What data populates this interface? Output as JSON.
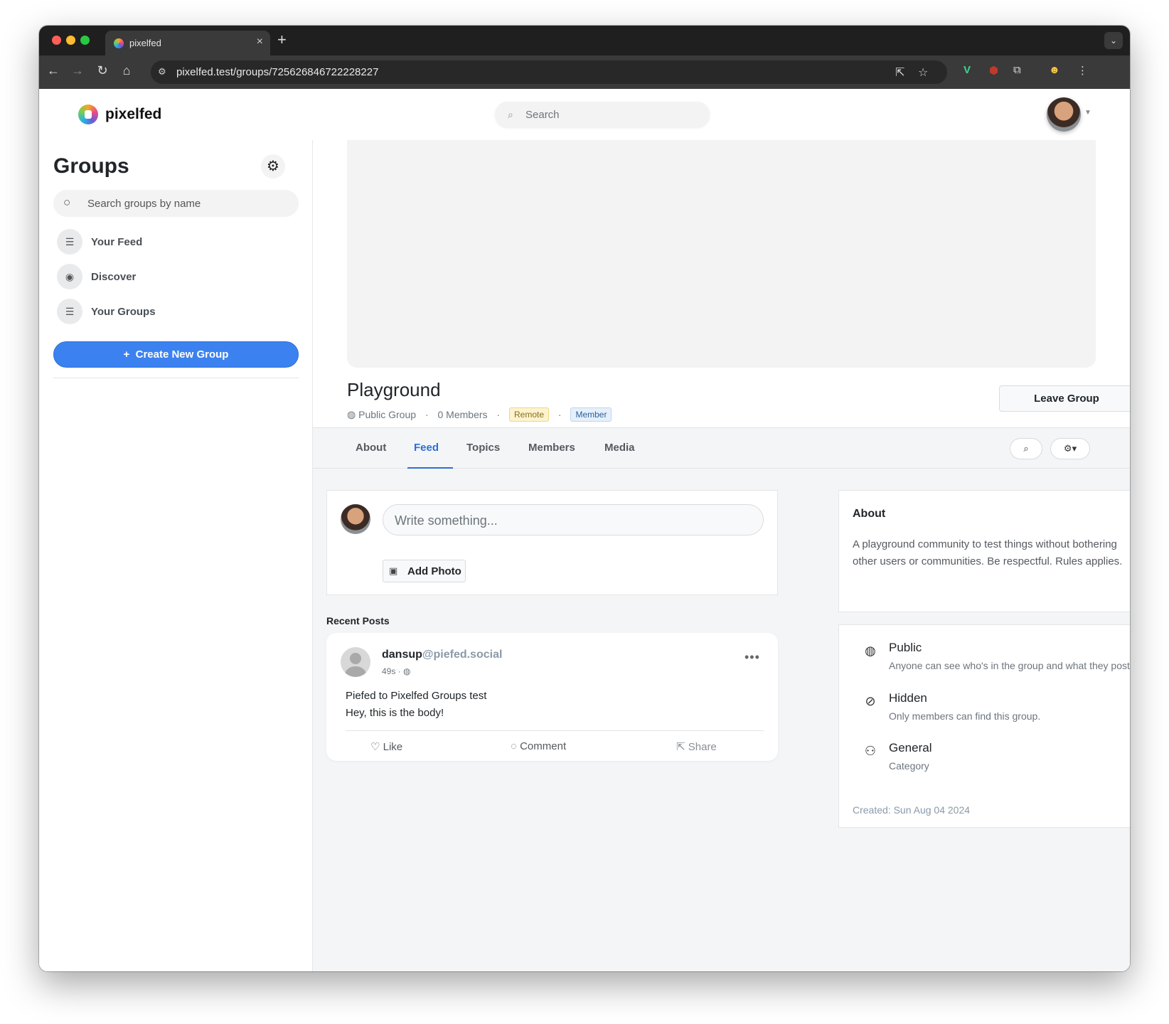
{
  "browser": {
    "tab_title": "pixelfed",
    "url": "pixelfed.test/groups/725626846722228227",
    "colors": {
      "close": "#ff5f57",
      "minimize": "#febc2e",
      "maximize": "#28c840"
    }
  },
  "topnav": {
    "brand": "pixelfed",
    "search_placeholder": "Search"
  },
  "sidebar": {
    "title": "Groups",
    "search_placeholder": "Search groups by name",
    "items": [
      {
        "label": "Your Feed",
        "icon": "list-icon"
      },
      {
        "label": "Discover",
        "icon": "compass-icon"
      },
      {
        "label": "Your Groups",
        "icon": "list-icon"
      }
    ],
    "create_button": "Create New Group"
  },
  "group": {
    "name": "Playground",
    "privacy": "Public Group",
    "members": "0 Members",
    "badge_remote": "Remote",
    "badge_member": "Member",
    "leave_button": "Leave Group",
    "tabs": [
      "About",
      "Feed",
      "Topics",
      "Members",
      "Media"
    ],
    "active_tab": "Feed"
  },
  "composer": {
    "placeholder": "Write something...",
    "add_photo": "Add Photo"
  },
  "feed": {
    "heading": "Recent Posts",
    "posts": [
      {
        "username": "dansup",
        "domain": "@piefed.social",
        "time": "49s",
        "title": "Piefed to Pixelfed Groups test",
        "body": "Hey, this is the body!",
        "actions": {
          "like": "Like",
          "comment": "Comment",
          "share": "Share"
        }
      }
    ]
  },
  "about": {
    "heading": "About",
    "text": "A playground community to test things without bothering other users or communities. Be respectful. Rules applies."
  },
  "info": {
    "rows": [
      {
        "title": "Public",
        "subtitle": "Anyone can see who's in the group and what they post.",
        "icon": "globe-icon"
      },
      {
        "title": "Hidden",
        "subtitle": "Only members can find this group.",
        "icon": "eye-slash-icon"
      },
      {
        "title": "General",
        "subtitle": "Category",
        "icon": "users-icon"
      }
    ],
    "created": "Created: Sun Aug 04 2024"
  },
  "accent_color": "#3b82f0"
}
